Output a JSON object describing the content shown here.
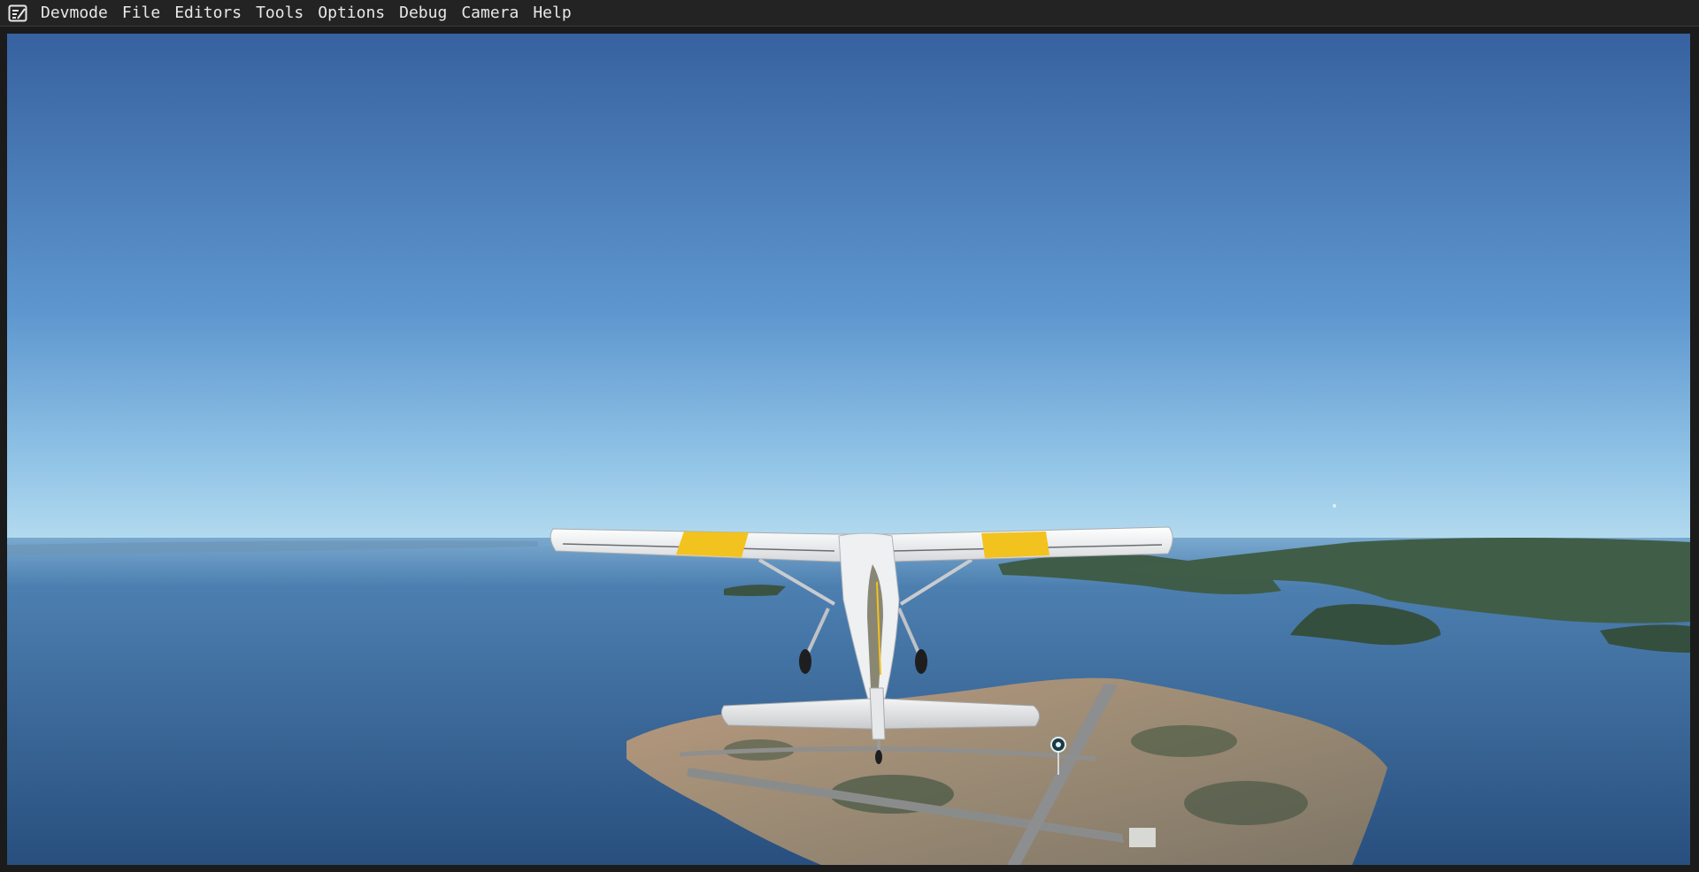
{
  "menubar": {
    "logo_icon": "devmode-notepad-icon",
    "items": [
      {
        "label": "Devmode"
      },
      {
        "label": "File"
      },
      {
        "label": "Editors"
      },
      {
        "label": "Tools"
      },
      {
        "label": "Options"
      },
      {
        "label": "Debug"
      },
      {
        "label": "Camera"
      },
      {
        "label": "Help"
      }
    ]
  },
  "scene": {
    "sky_top_color": "#3863a0",
    "sky_horizon_color": "#a9d3ec",
    "water_color": "#3e6e9e",
    "aircraft_colors": {
      "body": "#f1f1f1",
      "stripe": "#f2c21f"
    },
    "icons": [
      "airplane-rear-view",
      "waypoint-marker-icon"
    ]
  }
}
